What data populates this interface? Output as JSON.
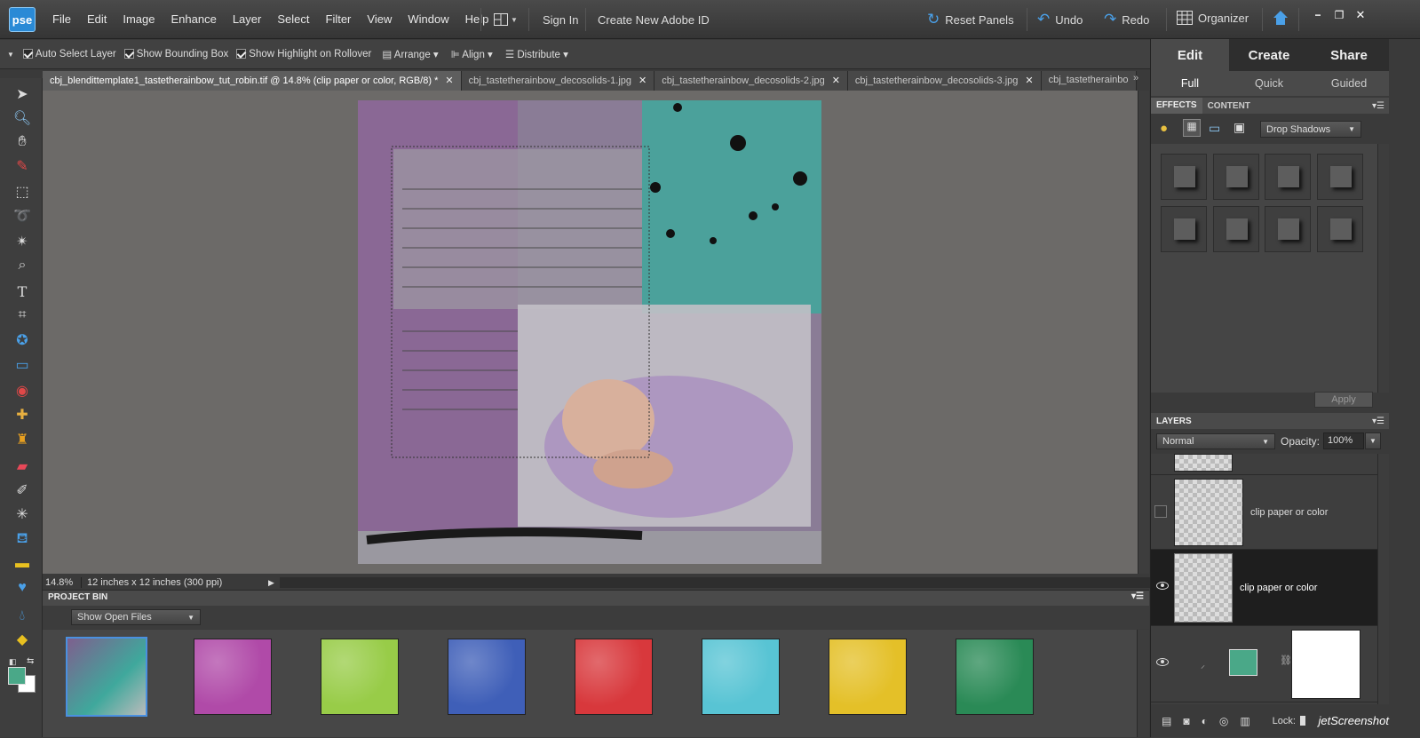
{
  "app": {
    "logo": "pse"
  },
  "menu": [
    "File",
    "Edit",
    "Image",
    "Enhance",
    "Layer",
    "Select",
    "Filter",
    "View",
    "Window",
    "Help"
  ],
  "account": {
    "sign_in": "Sign In",
    "create_id": "Create New Adobe ID"
  },
  "actions": {
    "reset_panels": "Reset Panels",
    "undo": "Undo",
    "redo": "Redo",
    "organizer": "Organizer"
  },
  "options": {
    "auto_select": "Auto Select Layer",
    "bounding_box": "Show Bounding Box",
    "highlight": "Show Highlight on Rollover",
    "arrange": "Arrange",
    "align": "Align",
    "distribute": "Distribute"
  },
  "doc_tabs": [
    {
      "label": "cbj_blendittemplate1_tastetherainbow_tut_robin.tif @ 14.8% (clip paper or color, RGB/8) *",
      "active": true
    },
    {
      "label": "cbj_tastetherainbow_decosolids-1.jpg",
      "active": false
    },
    {
      "label": "cbj_tastetherainbow_decosolids-2.jpg",
      "active": false
    },
    {
      "label": "cbj_tastetherainbow_decosolids-3.jpg",
      "active": false
    },
    {
      "label": "cbj_tastetherainbo",
      "active": false
    }
  ],
  "status": {
    "zoom": "14.8%",
    "doc_size": "12 inches x 12 inches (300 ppi)"
  },
  "project_bin": {
    "title": "PROJECT BIN",
    "filter": "Show Open Files",
    "thumb_colors": [
      "#b04aa8",
      "#98cc48",
      "#3f5fb8",
      "#d8383c",
      "#58c4d4",
      "#e4c028",
      "#2a8a56"
    ]
  },
  "right_panel": {
    "modes": [
      "Edit",
      "Create",
      "Share"
    ],
    "submodes": [
      "Full",
      "Quick",
      "Guided"
    ],
    "panel_tabs": [
      "EFFECTS",
      "CONTENT"
    ],
    "effects_dropdown": "Drop Shadows",
    "apply": "Apply",
    "layers_title": "LAYERS",
    "blend_mode": "Normal",
    "opacity_label": "Opacity:",
    "opacity_value": "100%",
    "layers": [
      {
        "name": "clip paper or color",
        "selected": false
      },
      {
        "name": "clip paper or color",
        "selected": true
      }
    ],
    "swatch_color": "#4aa888",
    "lock_label": "Lock:"
  },
  "watermark": "jetScreenshot"
}
